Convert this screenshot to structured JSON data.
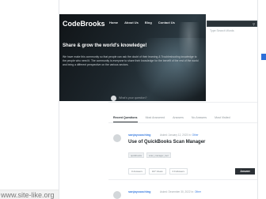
{
  "site": {
    "logo": "CodeBrooks",
    "nav": [
      "Home",
      "About Us",
      "Blog",
      "Contact Us"
    ]
  },
  "hero": {
    "title": "Share & grow the world's knowledge!",
    "text": "We have make this community so that people can ask the doubt of their learning & Troubleshooting knowledge to the people who need it. The community is everyone to share their knowledge for the benefit of the rest of the world and bring a different perspective on the various sectors."
  },
  "search": {
    "placeholder": "Type Search Words"
  },
  "ask": {
    "placeholder": "What's your question?"
  },
  "tabs": [
    "Recent Questions",
    "Most Answered",
    "Answers",
    "No Answers",
    "Most Visited"
  ],
  "questions": [
    {
      "author": "sanjaycoaching",
      "meta_prefix": "Asked: January 12, 2023  In:",
      "category": "Other",
      "title": "Use of QuickBooks Scan Manager",
      "tags": [
        "quickbooks",
        "scan_manager_tool"
      ],
      "stats": [
        "0 Answers",
        "167 Views",
        "0 Followers"
      ],
      "answer_label": "Answer"
    },
    {
      "author": "sanjaycoaching",
      "meta_prefix": "Asked: December 30, 2022  In:",
      "category": "Other"
    }
  ],
  "footer": {
    "link": "www.site-like.org"
  },
  "colors": {
    "accent": "#3b7de0",
    "brand_blue": "#2e6fd8",
    "dark": "#2b3035"
  }
}
